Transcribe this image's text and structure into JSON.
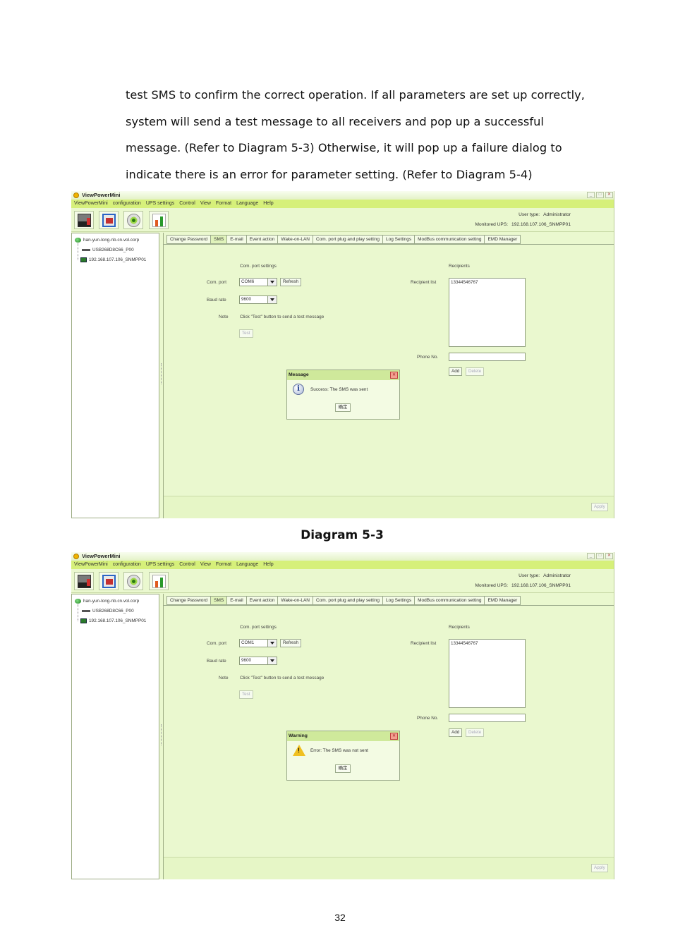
{
  "paragraph": {
    "lines": [
      "test SMS to confirm the correct operation. If all parameters are set up correctly,",
      "system will send a test message to all receivers and pop up a successful",
      "message. (Refer to Diagram 5-3) Otherwise, it will pop up a failure dialog to",
      "indicate there is an error for parameter setting. (Refer to Diagram 5-4)"
    ]
  },
  "caption1": "Diagram 5-3",
  "page_number": "32",
  "window": {
    "title": "ViewPowerMini",
    "menu": [
      "ViewPowerMini",
      "configuration",
      "UPS settings",
      "Control",
      "View",
      "Format",
      "Language",
      "Help"
    ],
    "user_type_label": "User type:",
    "user_type_value": "Administrator",
    "monitored_label": "Monitored UPS:",
    "monitored_value": "192.168.107.106_SNMPP01",
    "tree": {
      "root": "han-yun-long-nb.cn.vol.corp",
      "child1": "USB268D8C66_P00",
      "child2": "192.168.107.106_SNMPP01"
    },
    "tabs": [
      "Change Password",
      "SMS",
      "E-mail",
      "Event action",
      "Wake-on-LAN",
      "Com. port plug and play setting",
      "Log Settings",
      "ModBus communication setting",
      "EMD Manager"
    ],
    "com_port_settings": "Com. port settings",
    "com_port_label": "Com. port",
    "refresh": "Refresh",
    "baud_rate_label": "Baud rate",
    "baud_rate_value": "9600",
    "note_label": "Note",
    "note_text": "Click \"Test\" button to send a test message",
    "test": "Test",
    "recipients": "Recipients",
    "recipient_list_label": "Recipient list",
    "recipient_entry": "13344546767",
    "phone_label": "Phone No.",
    "add": "Add",
    "delete": "Delete",
    "apply": "Apply",
    "ok": "确定"
  },
  "screenshot1": {
    "com_port_value": "COM6",
    "dialog_title": "Message",
    "dialog_message": "Success: The SMS was sent"
  },
  "screenshot2": {
    "com_port_value": "COM1",
    "dialog_title": "Warning",
    "dialog_message": "Error: The SMS was not sent"
  }
}
